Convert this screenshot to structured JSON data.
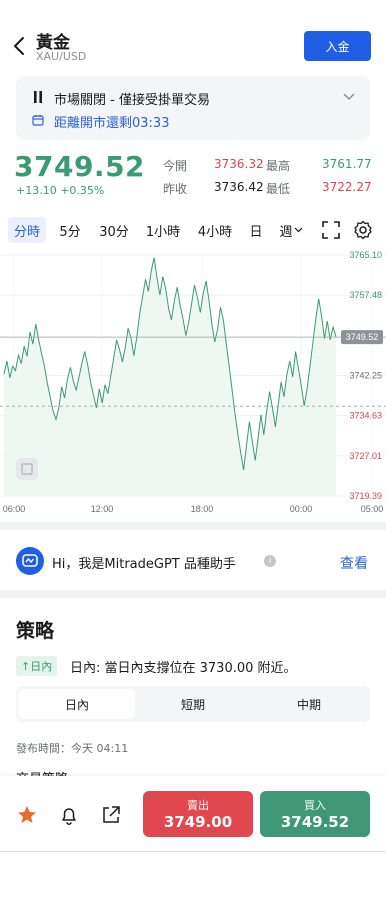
{
  "header": {
    "title": "黃金",
    "subtitle": "XAU/USD",
    "deposit_label": "入金"
  },
  "status": {
    "market_status": "市場關閉 - 僅接受掛單交易",
    "countdown": "距離開市還剩03:33"
  },
  "quote": {
    "price": "3749.52",
    "change": "+13.10 +0.35%",
    "open_label": "今開",
    "open_value": "3736.32",
    "high_label": "最高",
    "high_value": "3761.77",
    "prev_close_label": "昨收",
    "prev_close_value": "3736.42",
    "low_label": "最低",
    "low_value": "3722.27"
  },
  "timeframes": [
    "分時",
    "5分",
    "30分",
    "1小時",
    "4小時",
    "日",
    "週"
  ],
  "active_timeframe": "分時",
  "chart_data": {
    "type": "line",
    "x_ticks": [
      "06:00",
      "12:00",
      "18:00",
      "00:00",
      "05:00"
    ],
    "y_ticks": [
      "3765.10",
      "3757.48",
      "3749.52",
      "3742.25",
      "3734.63",
      "3727.01",
      "3719.39"
    ],
    "ylim": [
      3719.39,
      3765.1
    ],
    "current_price": 3749.52,
    "prev_close_line": 3736.42,
    "series": [
      {
        "values": [
          3742.5,
          3745.0,
          3741.8,
          3744.0,
          3743.2,
          3746.1,
          3744.5,
          3747.8,
          3745.9,
          3750.5,
          3748.2,
          3752.0,
          3749.1,
          3746.5,
          3744.0,
          3740.8,
          3738.2,
          3735.5,
          3733.9,
          3736.2,
          3740.1,
          3738.0,
          3741.6,
          3743.8,
          3741.2,
          3739.5,
          3742.0,
          3744.6,
          3746.8,
          3744.2,
          3741.0,
          3738.5,
          3736.1,
          3739.7,
          3737.0,
          3740.5,
          3738.8,
          3742.2,
          3745.5,
          3749.0,
          3747.2,
          3744.8,
          3747.6,
          3751.2,
          3749.3,
          3746.0,
          3749.5,
          3754.0,
          3757.2,
          3760.5,
          3758.2,
          3762.0,
          3764.6,
          3760.8,
          3757.5,
          3761.0,
          3758.7,
          3755.0,
          3752.8,
          3756.3,
          3759.0,
          3755.6,
          3753.0,
          3749.8,
          3752.5,
          3756.0,
          3759.4,
          3757.1,
          3754.2,
          3757.8,
          3760.2,
          3756.5,
          3752.0,
          3748.6,
          3751.0,
          3755.2,
          3752.8,
          3748.2,
          3744.0,
          3739.5,
          3735.0,
          3731.2,
          3727.6,
          3724.3,
          3729.0,
          3733.5,
          3729.8,
          3726.1,
          3730.4,
          3734.8,
          3731.0,
          3735.5,
          3739.2,
          3736.0,
          3732.5,
          3736.8,
          3741.0,
          3738.2,
          3742.5,
          3745.0,
          3742.0,
          3746.8,
          3743.5,
          3740.2,
          3736.5,
          3739.8,
          3744.0,
          3748.5,
          3753.0,
          3756.8,
          3753.5,
          3749.2,
          3752.6,
          3749.0,
          3751.5,
          3749.52
        ]
      }
    ]
  },
  "gpt": {
    "text": "Hi，我是MitradeGPT 品種助手",
    "link": "查看"
  },
  "strategy": {
    "title": "策略",
    "badge": "↑日內",
    "text": "日內: 當日內支撐位在 3730.00 附近。",
    "tabs": [
      "日內",
      "短期",
      "中期"
    ],
    "active_tab": "日內",
    "publish_time": "發布時間：今天 04:11",
    "section_label": "交易策略"
  },
  "trade": {
    "sell_label": "賣出",
    "sell_price": "3749.00",
    "buy_label": "買入",
    "buy_price": "3749.52"
  },
  "colors": {
    "up": "#3a9a72",
    "down": "#d8464d",
    "accent": "#2962d8",
    "sell": "#e1474e",
    "buy": "#3f9777"
  }
}
